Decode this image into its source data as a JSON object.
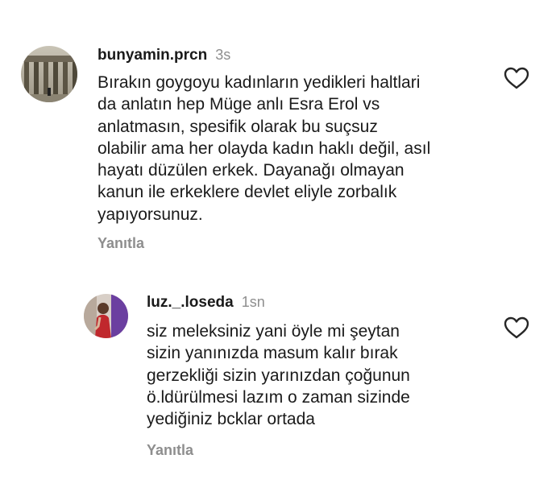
{
  "comments": [
    {
      "username": "bunyamin.prcn",
      "time": "3s",
      "lines": [
        "Bırakın goygoyu kadınların yedikleri haltlari",
        "da anlatın hep Müge anlı Esra Erol vs",
        "anlatmasın, spesifik olarak bu suçsuz",
        "olabilir ama her olayda kadın haklı değil,  asıl",
        "hayatı düzülen  erkek.  Dayanağı olmayan",
        "kanun ile erkeklere devlet eliyle zorbalık",
        "yapıyorsunuz."
      ],
      "reply_label": "Yanıtla",
      "like_icon": "heart-outline-icon"
    },
    {
      "username": "luz._.loseda",
      "time": "1sn",
      "lines": [
        "siz meleksiniz yani öyle mi şeytan",
        "sizin yanınızda masum kalır bırak",
        "gerzekliği sizin yarınızdan çoğunun",
        "ö.ldürülmesi lazım o zaman sizinde",
        "yediğiniz bcklar ortada"
      ],
      "reply_label": "Yanıtla",
      "like_icon": "heart-outline-icon"
    }
  ]
}
